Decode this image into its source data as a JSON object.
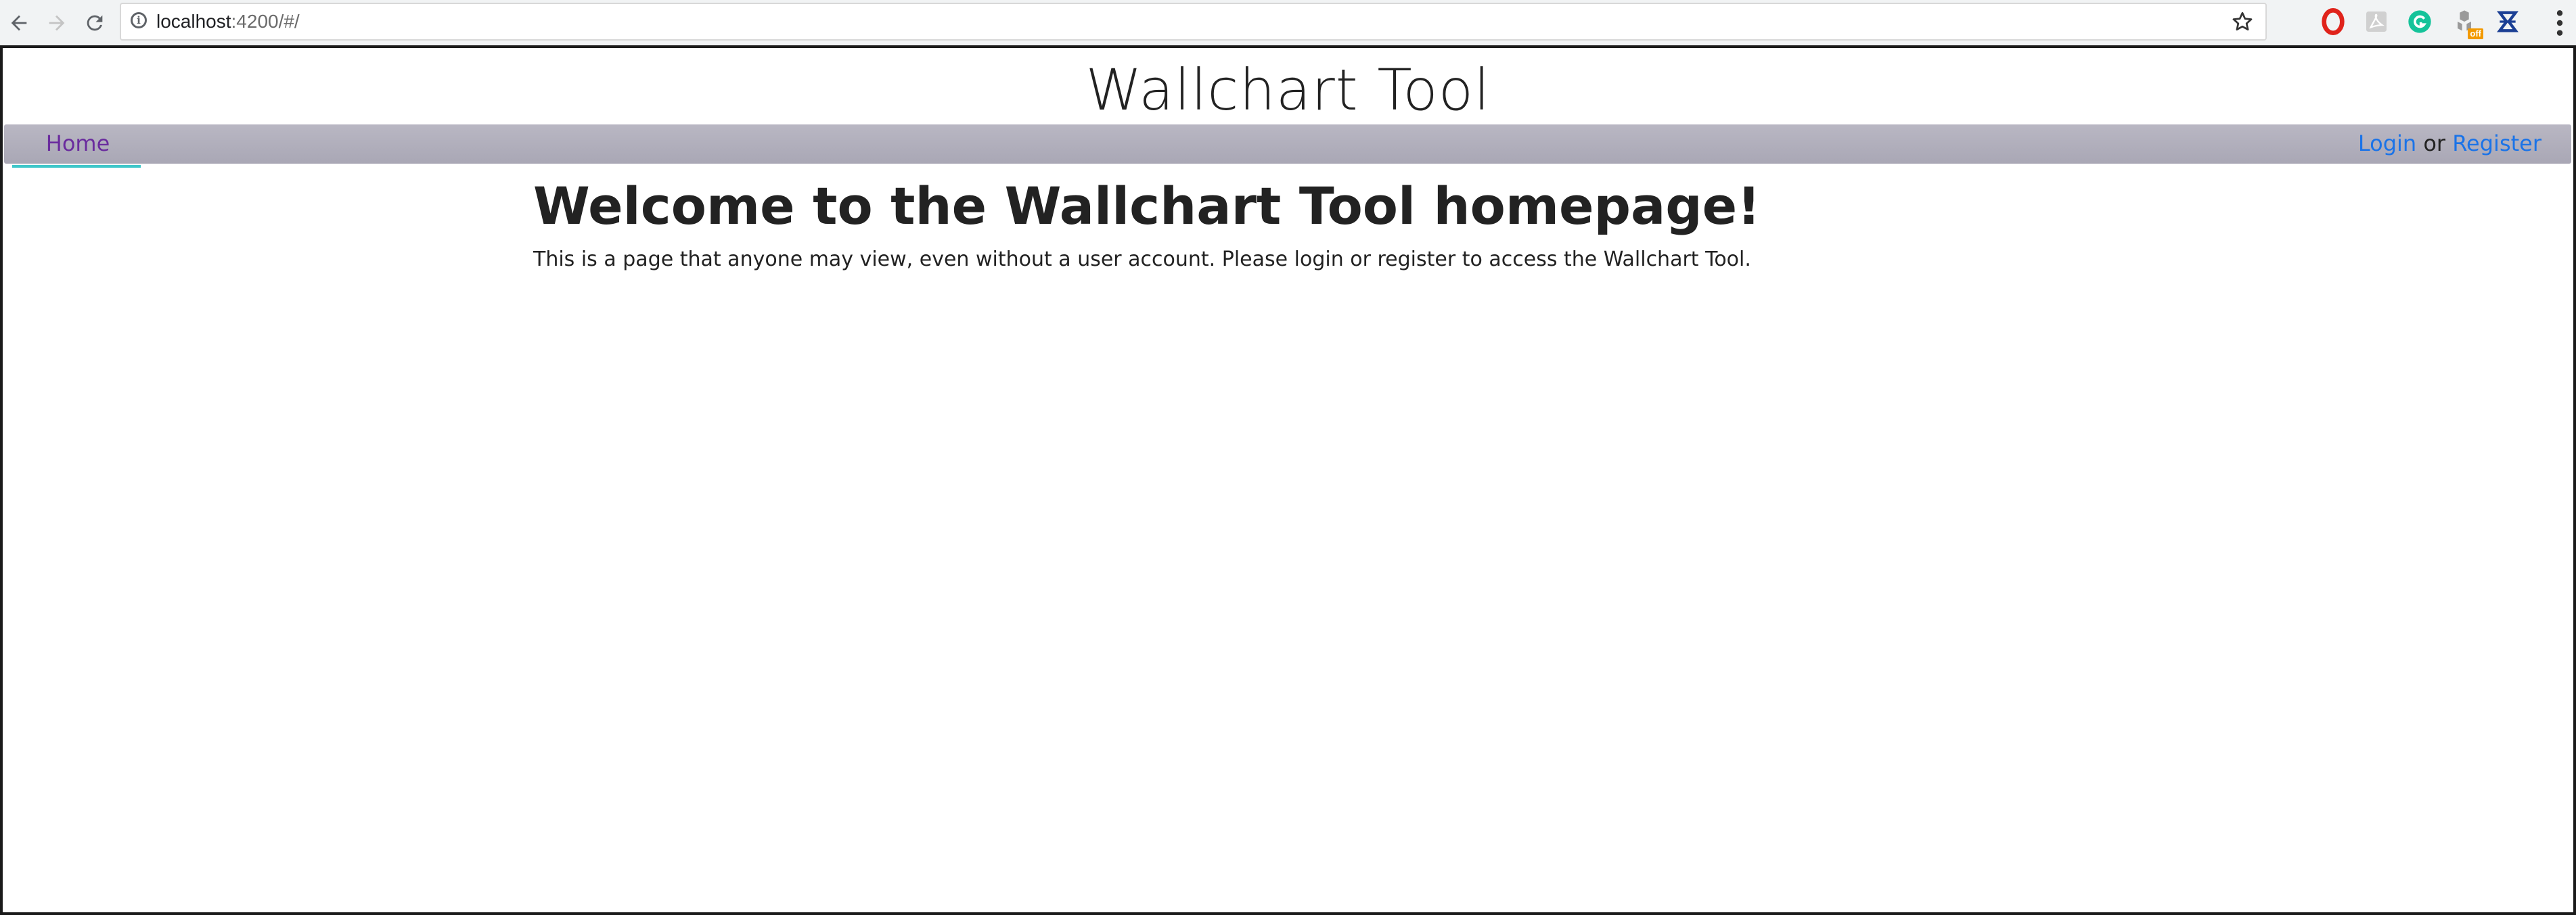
{
  "browser": {
    "url_host": "localhost",
    "url_rest": ":4200/#/",
    "extensions": [
      "opera-icon",
      "pdf-icon",
      "grammarly-icon",
      "extension-off-icon",
      "extension-blue-icon"
    ],
    "off_badge": "off"
  },
  "site": {
    "title": "Wallchart Tool"
  },
  "navbar": {
    "home_label": "Home",
    "login_label": "Login",
    "or_text": "or",
    "register_label": "Register"
  },
  "main": {
    "heading": "Welcome to the Wallchart Tool homepage!",
    "text": "This is a page that anyone may view, even without a user account. Please login or register to access the Wallchart Tool."
  },
  "colors": {
    "navbar": "#b4b2be",
    "home_link": "#6a2c9e",
    "active_underline": "#3fc6c9",
    "auth_link": "#1a73e8",
    "text": "#222222"
  }
}
